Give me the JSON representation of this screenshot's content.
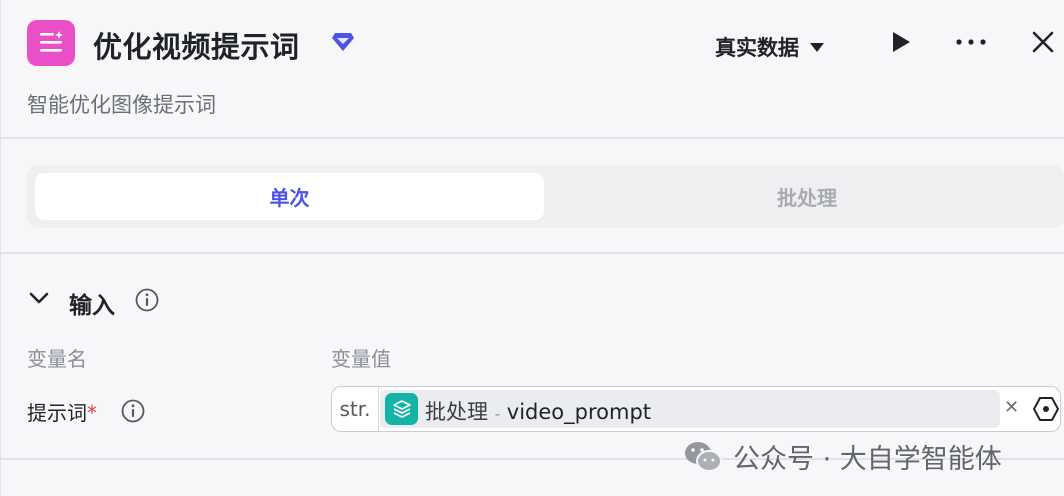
{
  "header": {
    "title": "优化视频提示词",
    "subtitle": "智能优化图像提示词",
    "mode_label": "真实数据",
    "icon": "list-sparkle-icon",
    "icon_color": "#ea4fc7",
    "badge_color": "#4d53e8"
  },
  "tabs": [
    {
      "label": "单次",
      "active": true
    },
    {
      "label": "批处理",
      "active": false
    }
  ],
  "input_section": {
    "title": "输入",
    "col_name": "变量名",
    "col_value": "变量值",
    "fields": [
      {
        "label": "提示词",
        "required_mark": "*",
        "type": "str.",
        "ref_node": "批处理",
        "ref_sep": "-",
        "ref_var": "video_prompt"
      }
    ]
  },
  "watermark": {
    "text": "公众号 · 大自学智能体"
  },
  "accent_color": "#4d53e8",
  "ref_icon_color": "#13b3a8"
}
